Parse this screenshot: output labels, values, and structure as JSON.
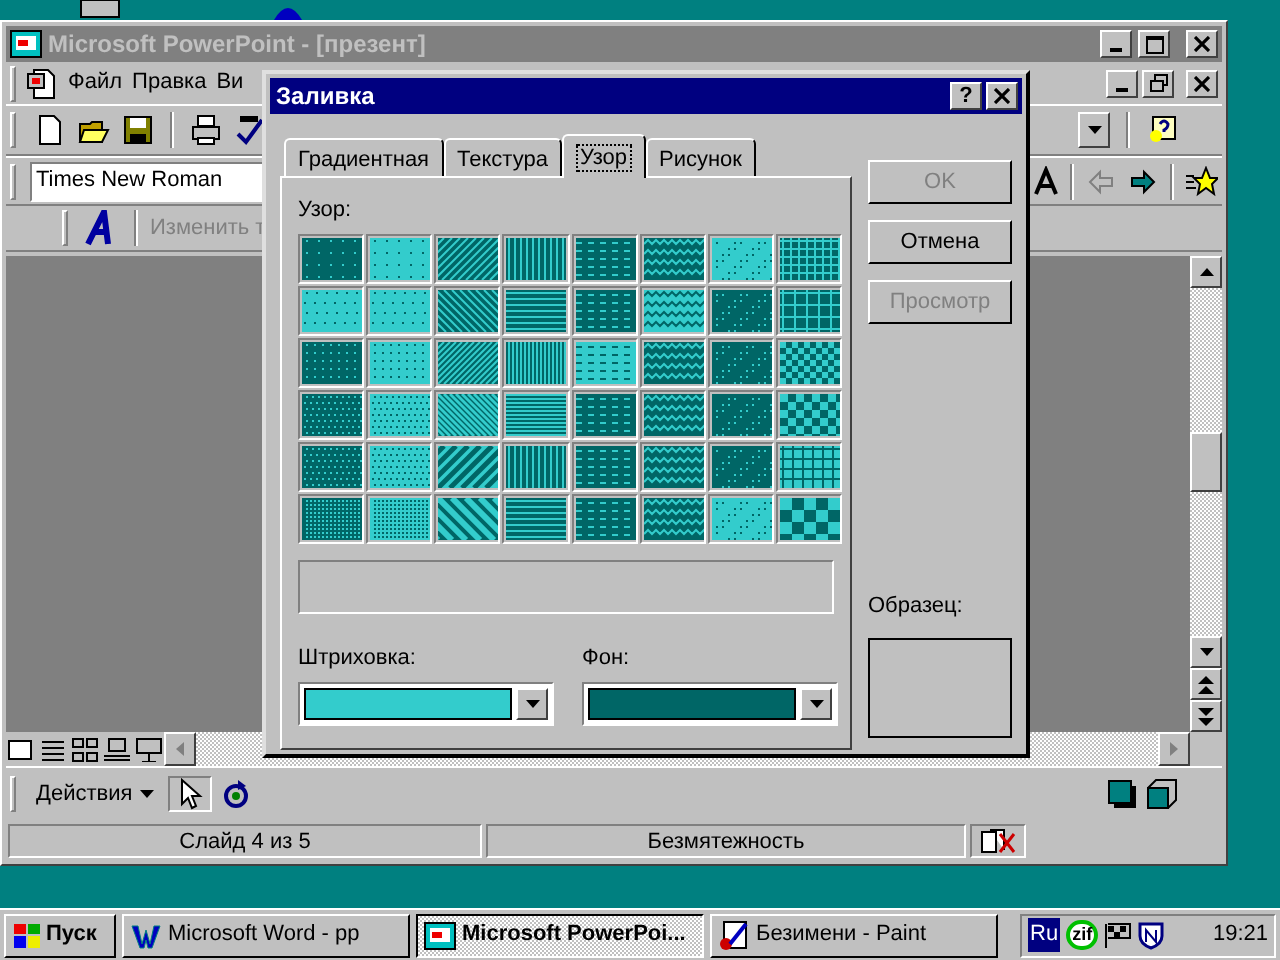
{
  "window": {
    "title": "Microsoft PowerPoint - [презент]"
  },
  "menu": [
    "Файл",
    "Правка",
    "Ви"
  ],
  "font_field": {
    "value": "Times New Roman"
  },
  "wordart_toolbar": {
    "label": "Изменить т"
  },
  "drawing_toolbar": {
    "actions": "Действия"
  },
  "status_bar": [
    "Слайд 4 из 5",
    "Безмятежность"
  ],
  "dialog": {
    "title": "Заливка",
    "help": "?",
    "tabs": [
      {
        "label": "Градиентная",
        "selected": false
      },
      {
        "label": "Текстура",
        "selected": false
      },
      {
        "label": "Узор",
        "selected": true
      },
      {
        "label": "Рисунок",
        "selected": false
      }
    ],
    "pattern_label": "Узор:",
    "hatch": {
      "label": "Штриховка:",
      "color": "#33cccc"
    },
    "background": {
      "label": "Фон:",
      "color": "#006666"
    },
    "sample_label": "Образец:",
    "buttons": [
      {
        "label": "OK",
        "disabled": true
      },
      {
        "label": "Отмена",
        "disabled": false
      },
      {
        "label": "Просмотр",
        "disabled": true
      }
    ]
  },
  "taskbar": {
    "start": "Пуск",
    "tasks": [
      {
        "label": "Microsoft Word - pp",
        "selected": false
      },
      {
        "label": "Microsoft PowerPoi...",
        "selected": true
      },
      {
        "label": "Безимени - Paint",
        "selected": false
      }
    ],
    "tray": [
      "Ru",
      "zif"
    ],
    "clock": "19:21"
  }
}
